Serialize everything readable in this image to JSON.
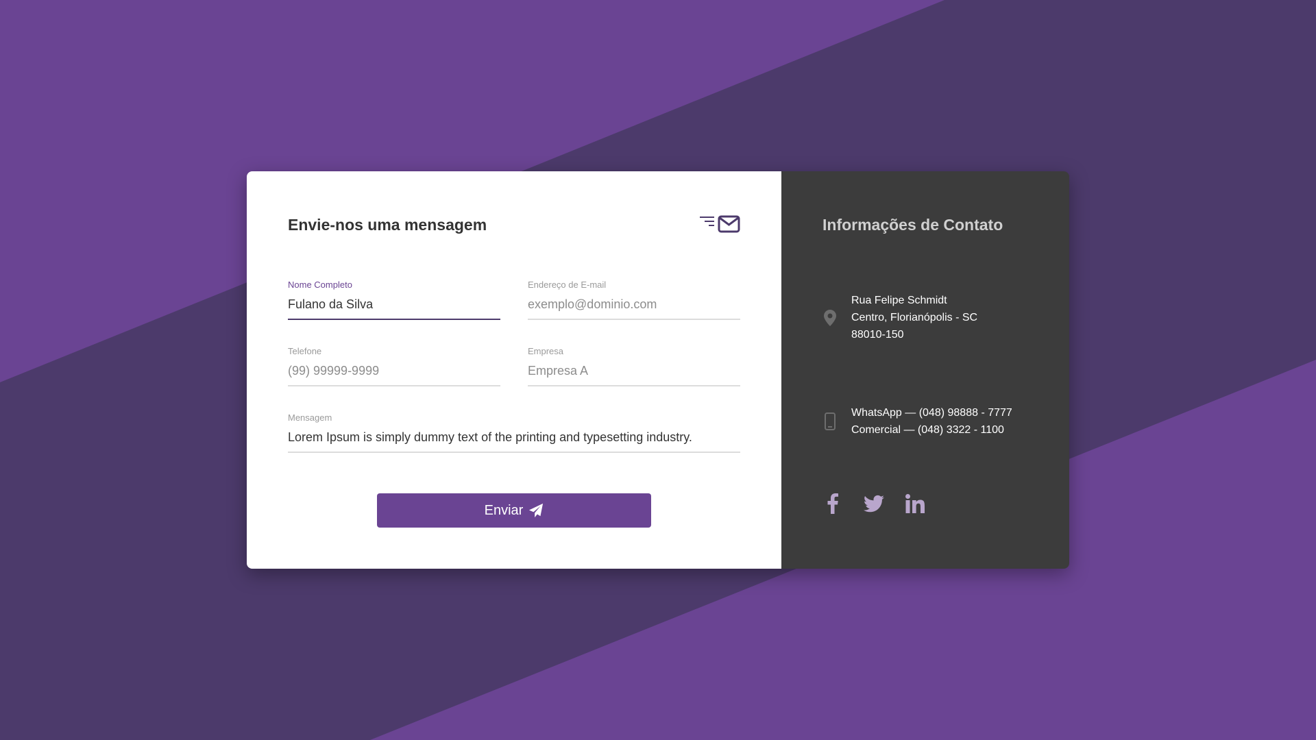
{
  "form": {
    "title": "Envie-nos uma mensagem",
    "fields": {
      "name": {
        "label": "Nome Completo",
        "value": "Fulano da Silva",
        "placeholder": ""
      },
      "email": {
        "label": "Endereço de E-mail",
        "value": "",
        "placeholder": "exemplo@dominio.com"
      },
      "phone": {
        "label": "Telefone",
        "value": "",
        "placeholder": "(99) 99999-9999"
      },
      "company": {
        "label": "Empresa",
        "value": "",
        "placeholder": "Empresa A"
      },
      "message": {
        "label": "Mensagem",
        "value": "Lorem Ipsum is simply dummy text of the printing and typesetting industry.",
        "placeholder": ""
      }
    },
    "submit_label": "Enviar"
  },
  "info": {
    "title": "Informações de Contato",
    "address": [
      "Rua Felipe Schmidt",
      "Centro, Florianópolis - SC",
      "88010-150"
    ],
    "phones": [
      "WhatsApp — (048) 98888 - 7777",
      "Comercial — (048) 3322 - 1100"
    ]
  },
  "socials": [
    {
      "name": "facebook-icon"
    },
    {
      "name": "twitter-icon"
    },
    {
      "name": "linkedin-icon"
    }
  ],
  "colors": {
    "accent": "#6a4493",
    "background_dark": "#4c3a6b",
    "background_light": "#6a4493",
    "info_panel": "#3c3c3c",
    "icon_muted": "#6e6e6e",
    "social_icon": "#b9a6cc"
  }
}
